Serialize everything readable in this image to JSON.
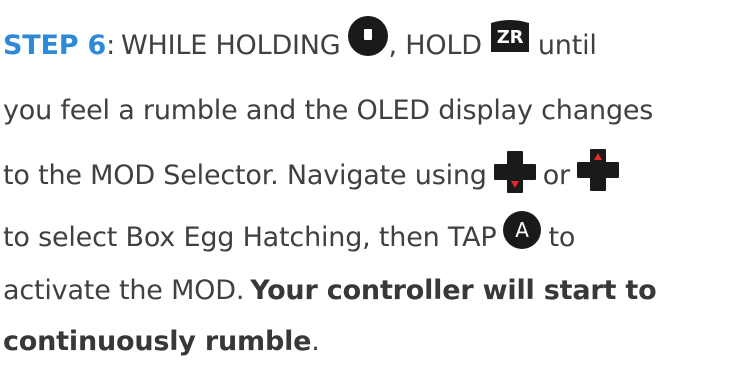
{
  "step": {
    "label": "STEP 6",
    "colon": ":",
    "line1_text_a": "WHILE HOLDING",
    "line1_text_b": ", HOLD",
    "line1_text_c": "until",
    "line2_text": "you feel a rumble and the OLED display changes",
    "line3_text_a": "to the MOD Selector.  Navigate using",
    "line3_text_b": "or",
    "line4_text_a": "to select Box Egg Hatching, then TAP",
    "line4_text_b": "to",
    "line5_text_a": "activate the MOD.",
    "line5_bold": "Your controller will start to",
    "line6_bold": "continuously rumble",
    "line6_end": "."
  },
  "icons": {
    "minus_button": "minus-button-icon",
    "zr_button": {
      "name": "zr-button-icon",
      "label": "ZR"
    },
    "dpad_down": "dpad-down-icon",
    "dpad_up": "dpad-up-icon",
    "a_button": {
      "name": "a-button-icon",
      "label": "A"
    }
  },
  "colors": {
    "step_accent": "#2e8ad6",
    "text": "#404040",
    "icon_dark": "#1a1a1a",
    "dpad_arrow": "#e8262b"
  }
}
